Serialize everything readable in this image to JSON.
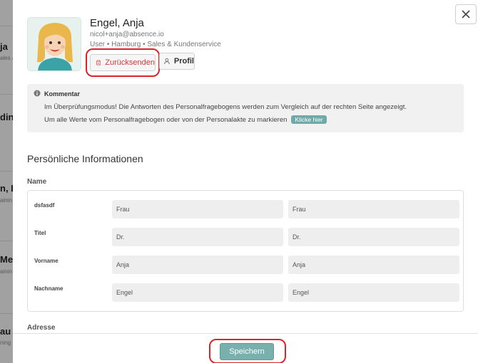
{
  "background_list": [
    {
      "text": "ja",
      "sub": "ales &"
    },
    {
      "text": "din",
      "sub": ""
    },
    {
      "text": "n, L",
      "sub": "ainin"
    },
    {
      "text": "Me",
      "sub": "ainin"
    },
    {
      "text": "au",
      "sub": "ning"
    }
  ],
  "profile": {
    "name": "Engel, Anja",
    "email": "nicol+anja@absence.io",
    "meta": "User • Hamburg • Sales & Kundenservice",
    "return_label": "Zurücksenden",
    "profile_label": "Profil"
  },
  "comment": {
    "title": "Kommentar",
    "line1": "Im Überprüfungsmodus! Die Antworten des Personalfragebogens werden zum Vergleich auf der rechten Seite angezeigt.",
    "line2": "Um alle Werte vom Personalfragebogen oder von der Personalakte zu markieren",
    "link": "Klicke hier"
  },
  "section": {
    "title": "Persönliche Informationen",
    "group": "Name",
    "rows": [
      {
        "label": "dsfasdf",
        "left": "Frau",
        "right": "Frau"
      },
      {
        "label": "Titel",
        "left": "Dr.",
        "right": "Dr."
      },
      {
        "label": "Vorname",
        "left": "Anja",
        "right": "Anja"
      },
      {
        "label": "Nachname",
        "left": "Engel",
        "right": "Engel"
      }
    ],
    "next_group": "Adresse"
  },
  "footer": {
    "save_label": "Speichern"
  },
  "colors": {
    "accent": "#78b0ae",
    "danger": "#d03a3a",
    "highlight": "#d9252a"
  },
  "icons": {
    "close": "close-icon",
    "return": "clipboard-icon",
    "profile": "user-icon",
    "info": "info-icon"
  }
}
